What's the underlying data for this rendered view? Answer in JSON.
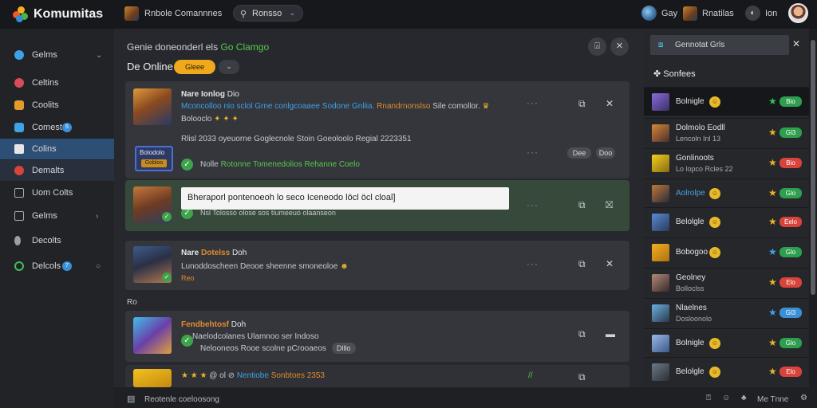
{
  "app": {
    "name": "Komumitas"
  },
  "topbar": {
    "nav_text": "Rnbole Comannnes",
    "search_text": "Ronsso",
    "user1": "Gay",
    "user2": "Rnatilas",
    "user3": "Ion"
  },
  "sidebar": {
    "items": [
      {
        "label": "Gelms",
        "chevron": "⌄"
      },
      {
        "label": "Celtins"
      },
      {
        "label": "Coolits"
      },
      {
        "label": "Comest",
        "badge": "5"
      },
      {
        "label": "Colins"
      },
      {
        "label": "Demalts"
      },
      {
        "label": "Uom Colts"
      },
      {
        "label": "Gelms",
        "chevron": "›"
      },
      {
        "label": "Decolts"
      },
      {
        "label": "Delcols",
        "badge": "7",
        "chevron": "○"
      }
    ]
  },
  "main": {
    "heading": "Genie doneonderl els",
    "heading_green": "Go Clamgo",
    "online_label": "De Online",
    "online_pill": "Gleee",
    "grey_pill": "⌄",
    "cards": [
      {
        "title": "Nare Ionlog",
        "title_suffix": "Dio",
        "line1_blue": "Mconcolloo nio sclol Grne conlgcoaaee Sodone Gnliia.",
        "line1_orange": "Rnandrnonslso",
        "line1_rest": "Sile comollor.",
        "line2": "Bolooclo",
        "line3": "Rlisl 2033 oyeuorne Goglecnole Stoin Goeoloolo Regial 2223351",
        "badge_line1": "Bolodolo",
        "badge_line2": "Gobloo",
        "check_text_dark": "Nolle",
        "check_text_green": "Rotonne Tomenedolios Rehanne Coelo",
        "pill1": "Dee",
        "pill2": "Doo"
      },
      {
        "tooltip": "Bheraporl pontenoeoh lo seco Iceneodo löcl öcl cloal]",
        "line": "Nsl Tolosso olose sos tiumeeuo olaanseon"
      },
      {
        "title": "Nare",
        "title_orange": "Dotelss",
        "title_suffix": "Doh",
        "line1": "Lunoddoscheen Deooe sheenne smoneoloe",
        "tag": "Reo"
      },
      {
        "section_label": "Ro",
        "title": "Fendbehtosf",
        "title_suffix": "Doh",
        "line1": "Naelodcolanes Ulamnoo ser Indoso",
        "line2": "Nelooneos Rooe scolne pCrooaeos",
        "pill": "Dlllo"
      },
      {
        "line_prefix": "@ ol ⊘",
        "line_blue": "Nentiobe",
        "line_orange": "Sonbtoes 2353",
        "line_green": "//"
      }
    ]
  },
  "footer": {
    "text": "Reotenle coeloosong",
    "right_text": "Me Tnne"
  },
  "right_panel": {
    "search_text": "Gennotat Grls",
    "section": "Sonfees",
    "rows": [
      {
        "name": "Bolnigle",
        "tag": "Bio",
        "tag_color": "#2e9e4f",
        "star_color": "#2fbf5b"
      },
      {
        "name": "Dolmolo Eodll",
        "sub": "Lencoln Inl 13",
        "tag": "Gl3",
        "tag_color": "#2e9e4f",
        "star_color": "#e8b22a"
      },
      {
        "name": "Gonlinoots",
        "sub": "Lo lopco Rcles 22",
        "tag": "Bio",
        "tag_color": "#d9433b",
        "star_color": "#e8b22a"
      },
      {
        "name": "Aolrolpe",
        "tag": "Glo",
        "tag_color": "#2e9e4f",
        "star_color": "#e8b22a",
        "name_color": "#4aa3e0"
      },
      {
        "name": "Belolgle",
        "tag": "Eelo",
        "tag_color": "#d9433b",
        "star_color": "#e8b22a"
      },
      {
        "name": "Bobogoo",
        "tag": "Glo",
        "tag_color": "#2e9e4f",
        "star_color": "#3fa1e6"
      },
      {
        "name": "Geolney",
        "sub": "Bolloclss",
        "tag": "Elo",
        "tag_color": "#d9433b",
        "star_color": "#e8b22a"
      },
      {
        "name": "Nlaelnes",
        "sub": "Dosloonolo",
        "tag": "Gl3",
        "tag_color": "#3a8fd6",
        "star_color": "#3fa1e6"
      },
      {
        "name": "Bolnigle",
        "tag": "Glo",
        "tag_color": "#2e9e4f",
        "star_color": "#e8b22a"
      },
      {
        "name": "Belolgle",
        "tag": "Elo",
        "tag_color": "#d9433b",
        "star_color": "#e8b22a"
      }
    ]
  },
  "colors": {
    "accent": "#2d4f76",
    "orange": "#f0a81c",
    "green": "#3fa34a"
  }
}
